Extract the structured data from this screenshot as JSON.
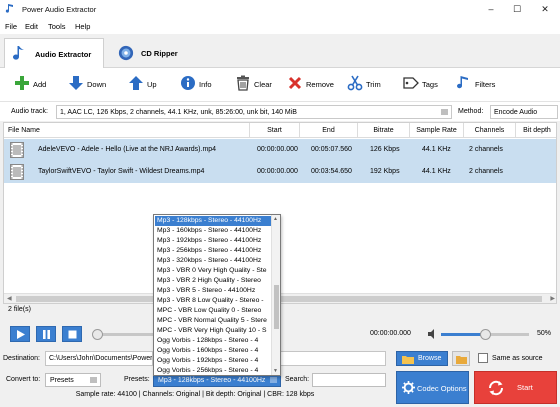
{
  "window": {
    "title": "Power Audio Extractor"
  },
  "menu": [
    "File",
    "Edit",
    "Tools",
    "Help"
  ],
  "tabs": [
    {
      "label": "Audio Extractor",
      "active": true
    },
    {
      "label": "CD Ripper",
      "active": false
    }
  ],
  "toolbar": {
    "add": "Add",
    "down": "Down",
    "up": "Up",
    "info": "Info",
    "clear": "Clear",
    "remove": "Remove",
    "trim": "Trim",
    "tags": "Tags",
    "filters": "Filters"
  },
  "track": {
    "label": "Audio track:",
    "value": "1, AAC LC, 126 Kbps, 2 channels, 44.1 KHz, unk, 85:26:00, unk bit, 140 MiB",
    "method_label": "Method:",
    "method_value": "Encode Audio"
  },
  "table": {
    "columns": [
      "File Name",
      "Start",
      "End",
      "Bitrate",
      "Sample Rate",
      "Channels",
      "Bit depth"
    ],
    "rows": [
      {
        "name": "AdeleVEVO - Adele - Hello (Live at the NRJ Awards).mp4",
        "start": "00:00:00.000",
        "end": "00:05:07.560",
        "bitrate": "126 Kbps",
        "sample_rate": "44.1 KHz",
        "channels": "2 channels"
      },
      {
        "name": "TaylorSwiftVEVO - Taylor Swift - Wildest Dreams.mp4",
        "start": "00:00:00.000",
        "end": "00:03:54.650",
        "bitrate": "192 Kbps",
        "sample_rate": "44.1 KHz",
        "channels": "2 channels"
      }
    ]
  },
  "file_count": "2 file(s)",
  "player": {
    "time": "00:00:00.000",
    "volume": "50%",
    "volume_level": 0.5
  },
  "destination": {
    "label": "Destination:",
    "path": "C:\\Users\\John\\Documents\\Power",
    "browse": "Browse",
    "same_as_source": "Same as source"
  },
  "convert": {
    "label": "Convert to:",
    "value": "Presets",
    "presets_label": "Presets:",
    "presets_value": "Mp3 - 128kbps - Stereo - 44100Hz",
    "search_label": "Search:"
  },
  "buttons": {
    "codec_options": "Codec Options",
    "start": "Start"
  },
  "status": "Sample rate: 44100 | Channels: Original | Bit depth: Original | CBR: 128 kbps",
  "preset_list": [
    "Mp3 - 128kbps - Stereo - 44100Hz",
    "Mp3 - 160kbps - Stereo - 44100Hz",
    "Mp3 - 192kbps - Stereo - 44100Hz",
    "Mp3 - 256kbps - Stereo - 44100Hz",
    "Mp3 - 320kbps - Stereo - 44100Hz",
    "Mp3 - VBR 0 Very High Quality - Ste",
    "Mp3 - VBR 2 High Quality - Stereo",
    "Mp3 - VBR 5 - Stereo - 44100Hz",
    "Mp3 - VBR 8 Low Quality - Stereo -",
    "MPC - VBR Low Quality 0 - Stereo",
    "MPC - VBR Normal Quality 5 - Stere",
    "MPC - VBR Very High Quality 10 - S",
    "Ogg Vorbis - 128kbps - Stereo - 4",
    "Ogg Vorbis - 160kbps - Stereo - 4",
    "Ogg Vorbis - 192kbps - Stereo - 4",
    "Ogg Vorbis - 256kbps - Stereo - 4"
  ],
  "colors": {
    "accent": "#3b7fd0",
    "selected_row": "#c9def0",
    "start_button": "#e8413b"
  }
}
